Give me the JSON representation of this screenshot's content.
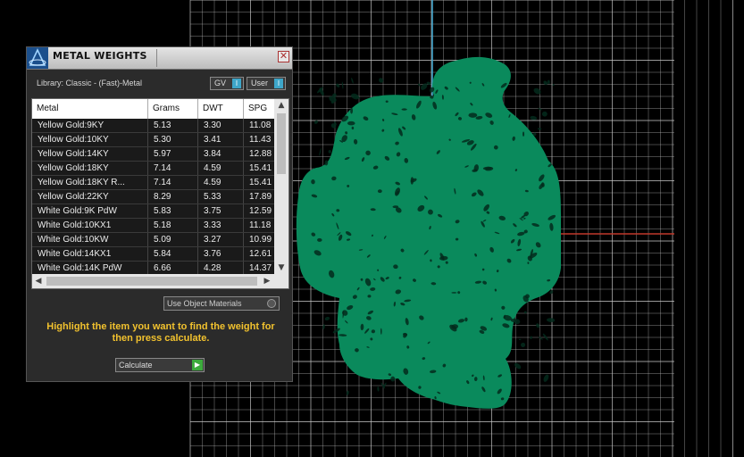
{
  "viewport": {
    "shape_color": "#0a8a5c",
    "grid_color": "#c9c9c9",
    "axis_y_color": "#3fa7d0",
    "axis_x_color": "#c0392b",
    "background": "#000000"
  },
  "panel": {
    "title": "METAL WEIGHTS",
    "library_label": "Library: Classic - (Fast)-Metal",
    "gv_label": "GV",
    "user_label": "User",
    "toggle_knob": "I",
    "table": {
      "columns": [
        "Metal",
        "Grams",
        "DWT",
        "SPG"
      ],
      "rows": [
        [
          "Yellow Gold:9KY",
          "5.13",
          "3.30",
          "11.08"
        ],
        [
          "Yellow Gold:10KY",
          "5.30",
          "3.41",
          "11.43"
        ],
        [
          "Yellow Gold:14KY",
          "5.97",
          "3.84",
          "12.88"
        ],
        [
          "Yellow Gold:18KY",
          "7.14",
          "4.59",
          "15.41"
        ],
        [
          "Yellow Gold:18KY R...",
          "7.14",
          "4.59",
          "15.41"
        ],
        [
          "Yellow Gold:22KY",
          "8.29",
          "5.33",
          "17.89"
        ],
        [
          "White Gold:9K PdW",
          "5.83",
          "3.75",
          "12.59"
        ],
        [
          "White Gold:10KX1",
          "5.18",
          "3.33",
          "11.18"
        ],
        [
          "White Gold:10KW",
          "5.09",
          "3.27",
          "10.99"
        ],
        [
          "White Gold:14KX1",
          "5.84",
          "3.76",
          "12.61"
        ],
        [
          "White Gold:14K PdW",
          "6.66",
          "4.28",
          "14.37"
        ]
      ]
    },
    "use_object_materials_label": "Use Object Materials",
    "hint": "Highlight the item you want to find the weight for then press calculate.",
    "calculate_label": "Calculate"
  }
}
